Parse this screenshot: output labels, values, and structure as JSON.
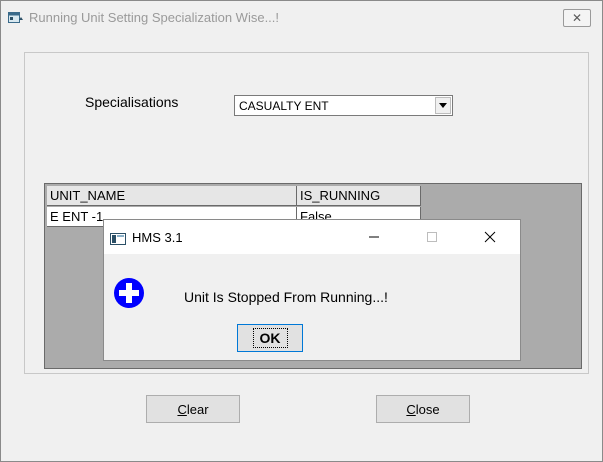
{
  "window": {
    "title": "Running Unit Setting Specialization Wise...!",
    "close_glyph": "✕"
  },
  "specialisation": {
    "label": "Specialisations",
    "value": "CASUALTY ENT"
  },
  "grid": {
    "columns": [
      "UNIT_NAME",
      "IS_RUNNING"
    ],
    "rows": [
      [
        "E ENT -1",
        "False"
      ]
    ]
  },
  "buttons": {
    "clear_mnemonic": "C",
    "clear_rest": "lear",
    "close_mnemonic": "C",
    "close_rest": "lose"
  },
  "message_box": {
    "title": "HMS 3.1",
    "minimize_glyph": "—",
    "maximize_glyph": "☐",
    "close_glyph": "✕",
    "text": "Unit Is Stopped From Running...!",
    "ok_label": "OK",
    "icon": "info-plus-icon"
  },
  "colors": {
    "info_icon": "#0000ff",
    "focus_border": "#0078d7"
  }
}
